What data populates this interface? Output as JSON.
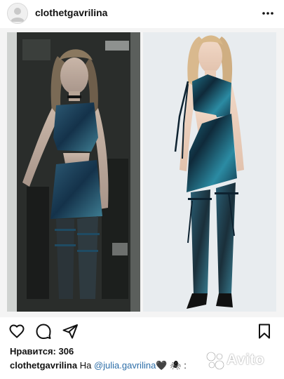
{
  "header": {
    "username": "clothetgavrilina",
    "avatar_icon": "user-avatar-icon",
    "more_icon": "more-horizontal-icon"
  },
  "media": {
    "left_photo": "model-backstage-photo",
    "right_photo": "model-studio-photo",
    "palette": {
      "dress_teal": "#1f6f86",
      "dress_dark": "#0f2a3a",
      "background_dark": "#1e211f",
      "studio_bg": "#e9edf0"
    }
  },
  "actions": {
    "like_icon": "heart-icon",
    "comment_icon": "comment-icon",
    "share_icon": "send-icon",
    "save_icon": "bookmark-icon"
  },
  "likes": {
    "label": "Нравится: 306"
  },
  "caption": {
    "username": "clothetgavrilina",
    "text_prefix": "На",
    "mention": "@julia.gavrilina",
    "emoji": "🖤 🕷 :"
  },
  "watermark": {
    "text": "Avito"
  }
}
